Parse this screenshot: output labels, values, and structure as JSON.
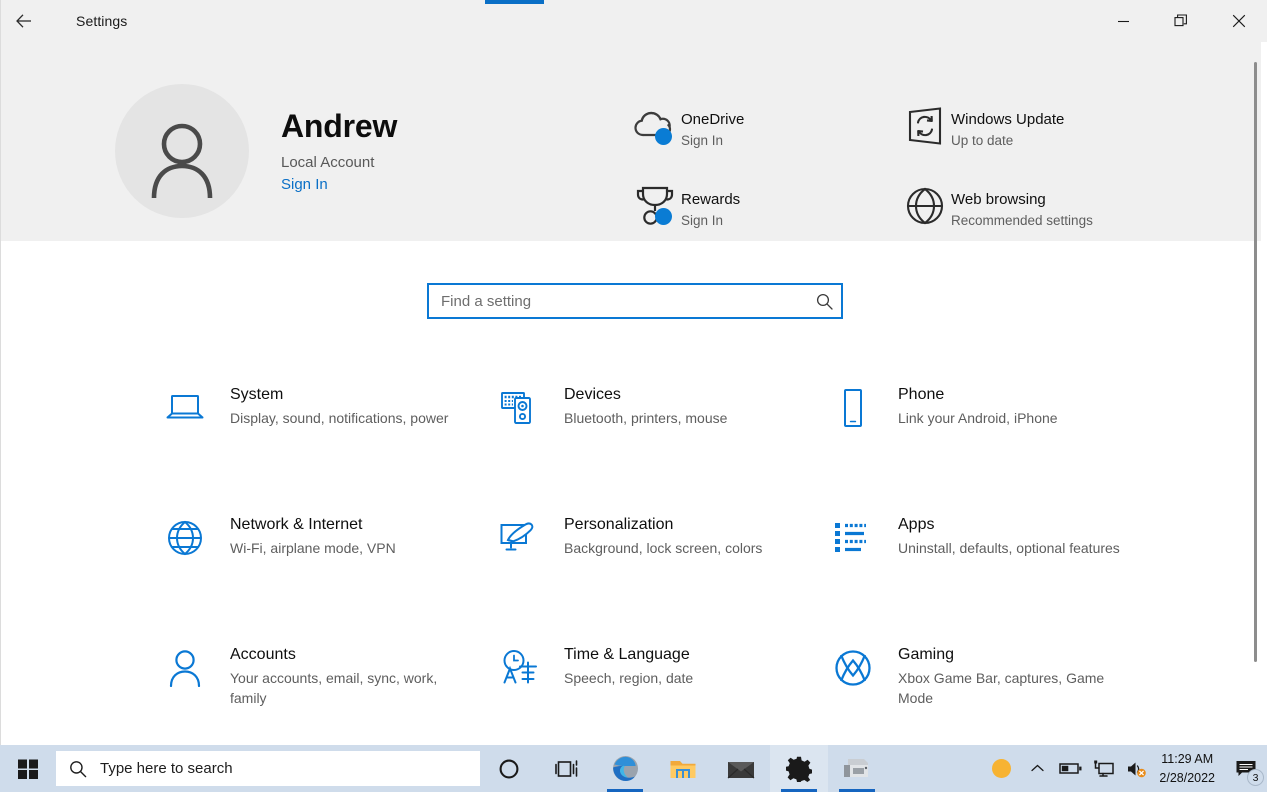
{
  "window": {
    "title": "Settings",
    "back_icon": "back-arrow-icon",
    "minimize_label": "—",
    "maximize_label": "❐",
    "close_label": "✕",
    "accent_color": "#0a6fc6"
  },
  "header": {
    "account": {
      "avatar_icon": "person-avatar-icon",
      "name": "Andrew",
      "account_type": "Local Account",
      "sign_in_label": "Sign In"
    },
    "quick_tiles": [
      {
        "icon": "onedrive-cloud-icon",
        "title": "OneDrive",
        "subtitle": "Sign In",
        "has_badge": true
      },
      {
        "icon": "windows-update-sync-icon",
        "title": "Windows Update",
        "subtitle": "Up to date",
        "has_badge": false
      },
      {
        "icon": "rewards-trophy-icon",
        "title": "Rewards",
        "subtitle": "Sign In",
        "has_badge": true
      },
      {
        "icon": "globe-web-icon",
        "title": "Web browsing",
        "subtitle": "Recommended settings",
        "has_badge": false
      }
    ]
  },
  "search": {
    "placeholder": "Find a setting",
    "value": "",
    "icon": "search-magnifier-icon"
  },
  "categories": [
    {
      "icon": "laptop-system-icon",
      "title": "System",
      "subtitle": "Display, sound, notifications, power"
    },
    {
      "icon": "devices-printer-icon",
      "title": "Devices",
      "subtitle": "Bluetooth, printers, mouse"
    },
    {
      "icon": "phone-icon",
      "title": "Phone",
      "subtitle": "Link your Android, iPhone"
    },
    {
      "icon": "globe-network-icon",
      "title": "Network & Internet",
      "subtitle": "Wi-Fi, airplane mode, VPN"
    },
    {
      "icon": "paintbrush-personalization-icon",
      "title": "Personalization",
      "subtitle": "Background, lock screen, colors"
    },
    {
      "icon": "apps-list-icon",
      "title": "Apps",
      "subtitle": "Uninstall, defaults, optional features"
    },
    {
      "icon": "person-accounts-icon",
      "title": "Accounts",
      "subtitle": "Your accounts, email, sync, work, family"
    },
    {
      "icon": "clock-language-icon",
      "title": "Time & Language",
      "subtitle": "Speech, region, date"
    },
    {
      "icon": "xbox-gaming-icon",
      "title": "Gaming",
      "subtitle": "Xbox Game Bar, captures, Game Mode"
    }
  ],
  "taskbar": {
    "start_icon": "windows-start-icon",
    "search": {
      "placeholder": "Type here to search",
      "value": "",
      "icon": "search-magnifier-icon"
    },
    "pinned": [
      {
        "icon": "cortana-circle-icon",
        "name": "cortana",
        "active": false,
        "running": false
      },
      {
        "icon": "task-view-icon",
        "name": "task-view",
        "active": false,
        "running": false
      },
      {
        "icon": "microsoft-edge-icon",
        "name": "microsoft-edge",
        "active": false,
        "running": true
      },
      {
        "icon": "file-explorer-icon",
        "name": "file-explorer",
        "active": false,
        "running": false
      },
      {
        "icon": "mail-envelope-icon",
        "name": "mail",
        "active": false,
        "running": false
      },
      {
        "icon": "settings-gear-icon",
        "name": "settings",
        "active": true,
        "running": true
      },
      {
        "icon": "printer-device-icon",
        "name": "printer",
        "active": false,
        "running": true
      }
    ],
    "tray": {
      "weather_icon": "sun-weather-icon",
      "chevron_icon": "chevron-up-icon",
      "battery_icon": "battery-icon",
      "network_icon": "ethernet-monitor-icon",
      "volume_icon": "volume-muted-icon",
      "time": "11:29 AM",
      "date": "2/28/2022",
      "action_center_icon": "notifications-icon",
      "notification_count": "3"
    }
  },
  "scrollbar": {
    "name": "vertical-scrollbar"
  }
}
